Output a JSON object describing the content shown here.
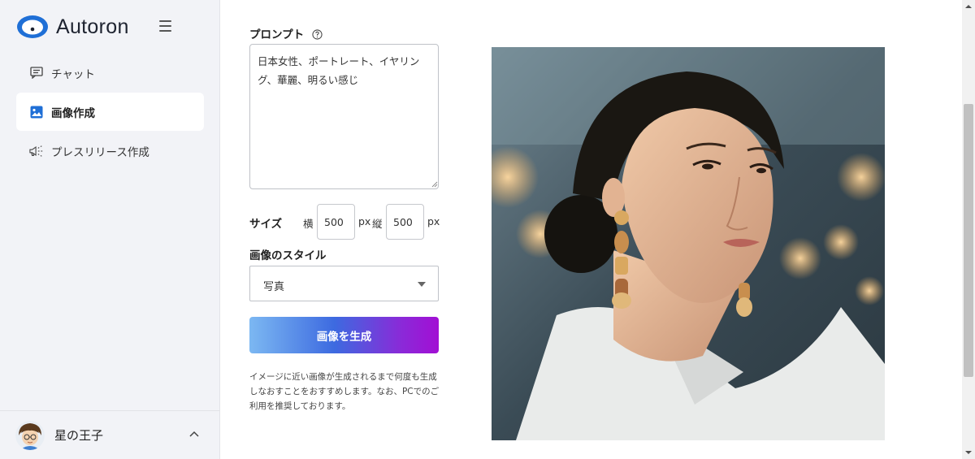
{
  "app": {
    "name": "Autoron"
  },
  "sidebar": {
    "items": [
      {
        "label": "チャット",
        "icon": "chat-icon",
        "active": false
      },
      {
        "label": "画像作成",
        "icon": "image-icon",
        "active": true
      },
      {
        "label": "プレスリリース作成",
        "icon": "megaphone-icon",
        "active": false
      }
    ]
  },
  "user": {
    "name": "星の王子"
  },
  "form": {
    "prompt_label": "プロンプト",
    "prompt_value": "日本女性、ポートレート、イヤリング、華麗、明るい感じ",
    "size_label": "サイズ",
    "width_label": "横",
    "width_value": "500",
    "height_label": "縦",
    "height_value": "500",
    "unit": "px",
    "style_label": "画像のスタイル",
    "style_value": "写真",
    "generate_label": "画像を生成",
    "note": "イメージに近い画像が生成されるまで何度も生成しなおすことをおすすめします。なお、PCでのご利用を推奨しております。"
  },
  "colors": {
    "accent": "#1f6fd6",
    "button_gradient": [
      "#7cb8f2",
      "#3d6ae0",
      "#8a2ad8",
      "#a20fd4"
    ],
    "sidebar_bg": "#f2f3f7"
  }
}
